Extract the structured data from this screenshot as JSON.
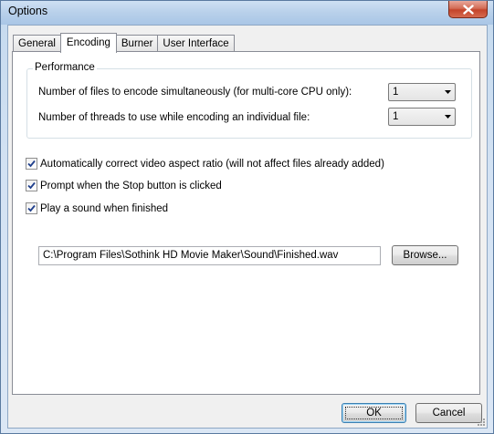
{
  "window": {
    "title": "Options"
  },
  "tabs": [
    {
      "label": "General",
      "active": false
    },
    {
      "label": "Encoding",
      "active": true
    },
    {
      "label": "Burner",
      "active": false
    },
    {
      "label": "User Interface",
      "active": false
    }
  ],
  "performance": {
    "legend": "Performance",
    "files_label": "Number of files to encode simultaneously (for multi-core CPU only):",
    "files_value": "1",
    "threads_label": "Number of threads to use while encoding an individual file:",
    "threads_value": "1"
  },
  "options": {
    "aspect_label": "Automatically correct video aspect ratio (will not affect files already added)",
    "aspect_checked": true,
    "prompt_label": "Prompt when the Stop button is clicked",
    "prompt_checked": true,
    "sound_label": "Play a sound when finished",
    "sound_checked": true
  },
  "sound_file": {
    "path": "C:\\Program Files\\Sothink HD Movie Maker\\Sound\\Finished.wav",
    "browse_label": "Browse..."
  },
  "footer": {
    "ok_label": "OK",
    "cancel_label": "Cancel"
  },
  "colors": {
    "titlebar": "#b8d0ea",
    "close": "#c4442a",
    "panel": "#ffffff",
    "dialog": "#f0f0f0",
    "check": "#1f3f8c"
  }
}
